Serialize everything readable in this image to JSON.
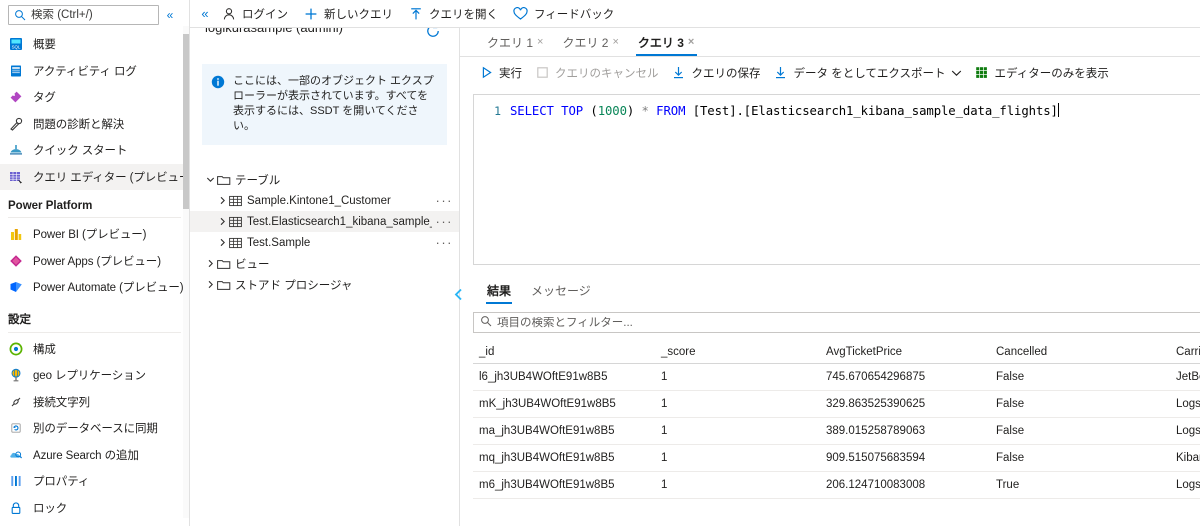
{
  "sidebar": {
    "search": {
      "placeholder": "検索 (Ctrl+/)"
    },
    "collapse_label": "«",
    "items": [
      {
        "label": "概要",
        "icon": "overview-icon"
      },
      {
        "label": "アクティビティ ログ",
        "icon": "activity-log-icon"
      },
      {
        "label": "タグ",
        "icon": "tag-icon"
      },
      {
        "label": "問題の診断と解決",
        "icon": "diagnose-solve-icon"
      },
      {
        "label": "クイック スタート",
        "icon": "quick-start-icon"
      },
      {
        "label": "クエリ エディター (プレビュー)",
        "icon": "query-editor-icon"
      }
    ],
    "groups": [
      {
        "title": "Power Platform",
        "items": [
          {
            "label": "Power BI (プレビュー)",
            "icon": "power-bi-icon"
          },
          {
            "label": "Power Apps (プレビュー)",
            "icon": "power-apps-icon"
          },
          {
            "label": "Power Automate (プレビュー)",
            "icon": "power-automate-icon"
          }
        ]
      },
      {
        "title": "設定",
        "items": [
          {
            "label": "構成",
            "icon": "configuration-icon"
          },
          {
            "label": "geo レプリケーション",
            "icon": "geo-replication-icon"
          },
          {
            "label": "接続文字列",
            "icon": "connection-strings-icon"
          },
          {
            "label": "別のデータベースに同期",
            "icon": "sync-database-icon"
          },
          {
            "label": "Azure Search の追加",
            "icon": "azure-search-icon"
          },
          {
            "label": "プロパティ",
            "icon": "properties-icon"
          },
          {
            "label": "ロック",
            "icon": "lock-icon"
          }
        ]
      }
    ]
  },
  "toolbar": {
    "collapse_icon": "«",
    "items": [
      {
        "label": "ログイン",
        "icon": "person-icon"
      },
      {
        "label": "新しいクエリ",
        "icon": "plus-icon"
      },
      {
        "label": "クエリを開く",
        "icon": "upload-arrow-icon"
      },
      {
        "label": "フィードバック",
        "icon": "heart-icon"
      }
    ]
  },
  "explorer": {
    "title": "logikurasample (admini)",
    "refresh_icon": "refresh-icon",
    "info": {
      "icon": "info-icon",
      "text": "ここには、一部のオブジェクト エクスプローラーが表示されています。すべてを表示するには、SSDT を開いてください。"
    },
    "collapse_icon": "chevron-left-icon",
    "tree": [
      {
        "label": "テーブル",
        "type": "folder",
        "level": 0,
        "expanded": true,
        "selected": false,
        "more": false
      },
      {
        "label": "Sample.Kintone1_Customer",
        "type": "table",
        "level": 1,
        "expanded": false,
        "selected": false,
        "more": true
      },
      {
        "label": "Test.Elasticsearch1_kibana_sample_",
        "type": "table",
        "level": 1,
        "expanded": false,
        "selected": true,
        "more": true
      },
      {
        "label": "Test.Sample",
        "type": "table",
        "level": 1,
        "expanded": false,
        "selected": false,
        "more": true
      },
      {
        "label": "ビュー",
        "type": "folder",
        "level": 0,
        "expanded": false,
        "selected": false,
        "more": false
      },
      {
        "label": "ストアド プロシージャ",
        "type": "folder",
        "level": 0,
        "expanded": false,
        "selected": false,
        "more": false
      }
    ]
  },
  "query_tabs": [
    {
      "label": "クエリ 1",
      "active": false,
      "close": "×"
    },
    {
      "label": "クエリ 2",
      "active": false,
      "close": "×"
    },
    {
      "label": "クエリ 3",
      "active": true,
      "close": "×"
    }
  ],
  "editor_toolbar": {
    "items": [
      {
        "label": "実行",
        "icon": "play-icon",
        "disabled": false,
        "caret": false
      },
      {
        "label": "クエリのキャンセル",
        "icon": "stop-square-icon",
        "disabled": true,
        "caret": false
      },
      {
        "label": "クエリの保存",
        "icon": "download-icon",
        "disabled": false,
        "caret": false
      },
      {
        "label": "データ をとしてエクスポート",
        "icon": "download-icon",
        "disabled": false,
        "caret": true
      },
      {
        "label": "エディターのみを表示",
        "icon": "grid-icon",
        "disabled": false,
        "caret": false
      }
    ]
  },
  "sql_editor": {
    "line_number": "1",
    "tokens": {
      "select": "SELECT",
      "top": "TOP",
      "paren_open": "(",
      "number": "1000",
      "paren_close": ")",
      "star": "*",
      "from": "FROM",
      "target": "[Test].[Elasticsearch1_kibana_sample_data_flights]"
    },
    "full_text": "SELECT TOP (1000) * FROM [Test].[Elasticsearch1_kibana_sample_data_flights]"
  },
  "results": {
    "tabs": [
      {
        "label": "結果",
        "active": true
      },
      {
        "label": "メッセージ",
        "active": false
      }
    ],
    "filter": {
      "placeholder": "項目の検索とフィルター...",
      "icon": "search-icon"
    },
    "columns": [
      "_id",
      "_score",
      "AvgTicketPrice",
      "Cancelled",
      "Carrier"
    ],
    "rows": [
      [
        "l6_jh3UB4WOftE91w8B5",
        "1",
        "745.670654296875",
        "False",
        "JetBeat"
      ],
      [
        "mK_jh3UB4WOftE91w8B5",
        "1",
        "329.863525390625",
        "False",
        "Logstas"
      ],
      [
        "ma_jh3UB4WOftE91w8B5",
        "1",
        "389.015258789063",
        "False",
        "Logstas"
      ],
      [
        "mq_jh3UB4WOftE91w8B5",
        "1",
        "909.515075683594",
        "False",
        "Kibana"
      ],
      [
        "m6_jh3UB4WOftE91w8B5",
        "1",
        "206.124710083008",
        "True",
        "Logstas"
      ]
    ]
  },
  "colors": {
    "accent": "#0078d4",
    "selected_bg": "#f3f2f1",
    "info_bg": "#eff6fc",
    "keyword_blue": "#0000ff",
    "number_green": "#098658",
    "gutter_blue": "#237893"
  }
}
